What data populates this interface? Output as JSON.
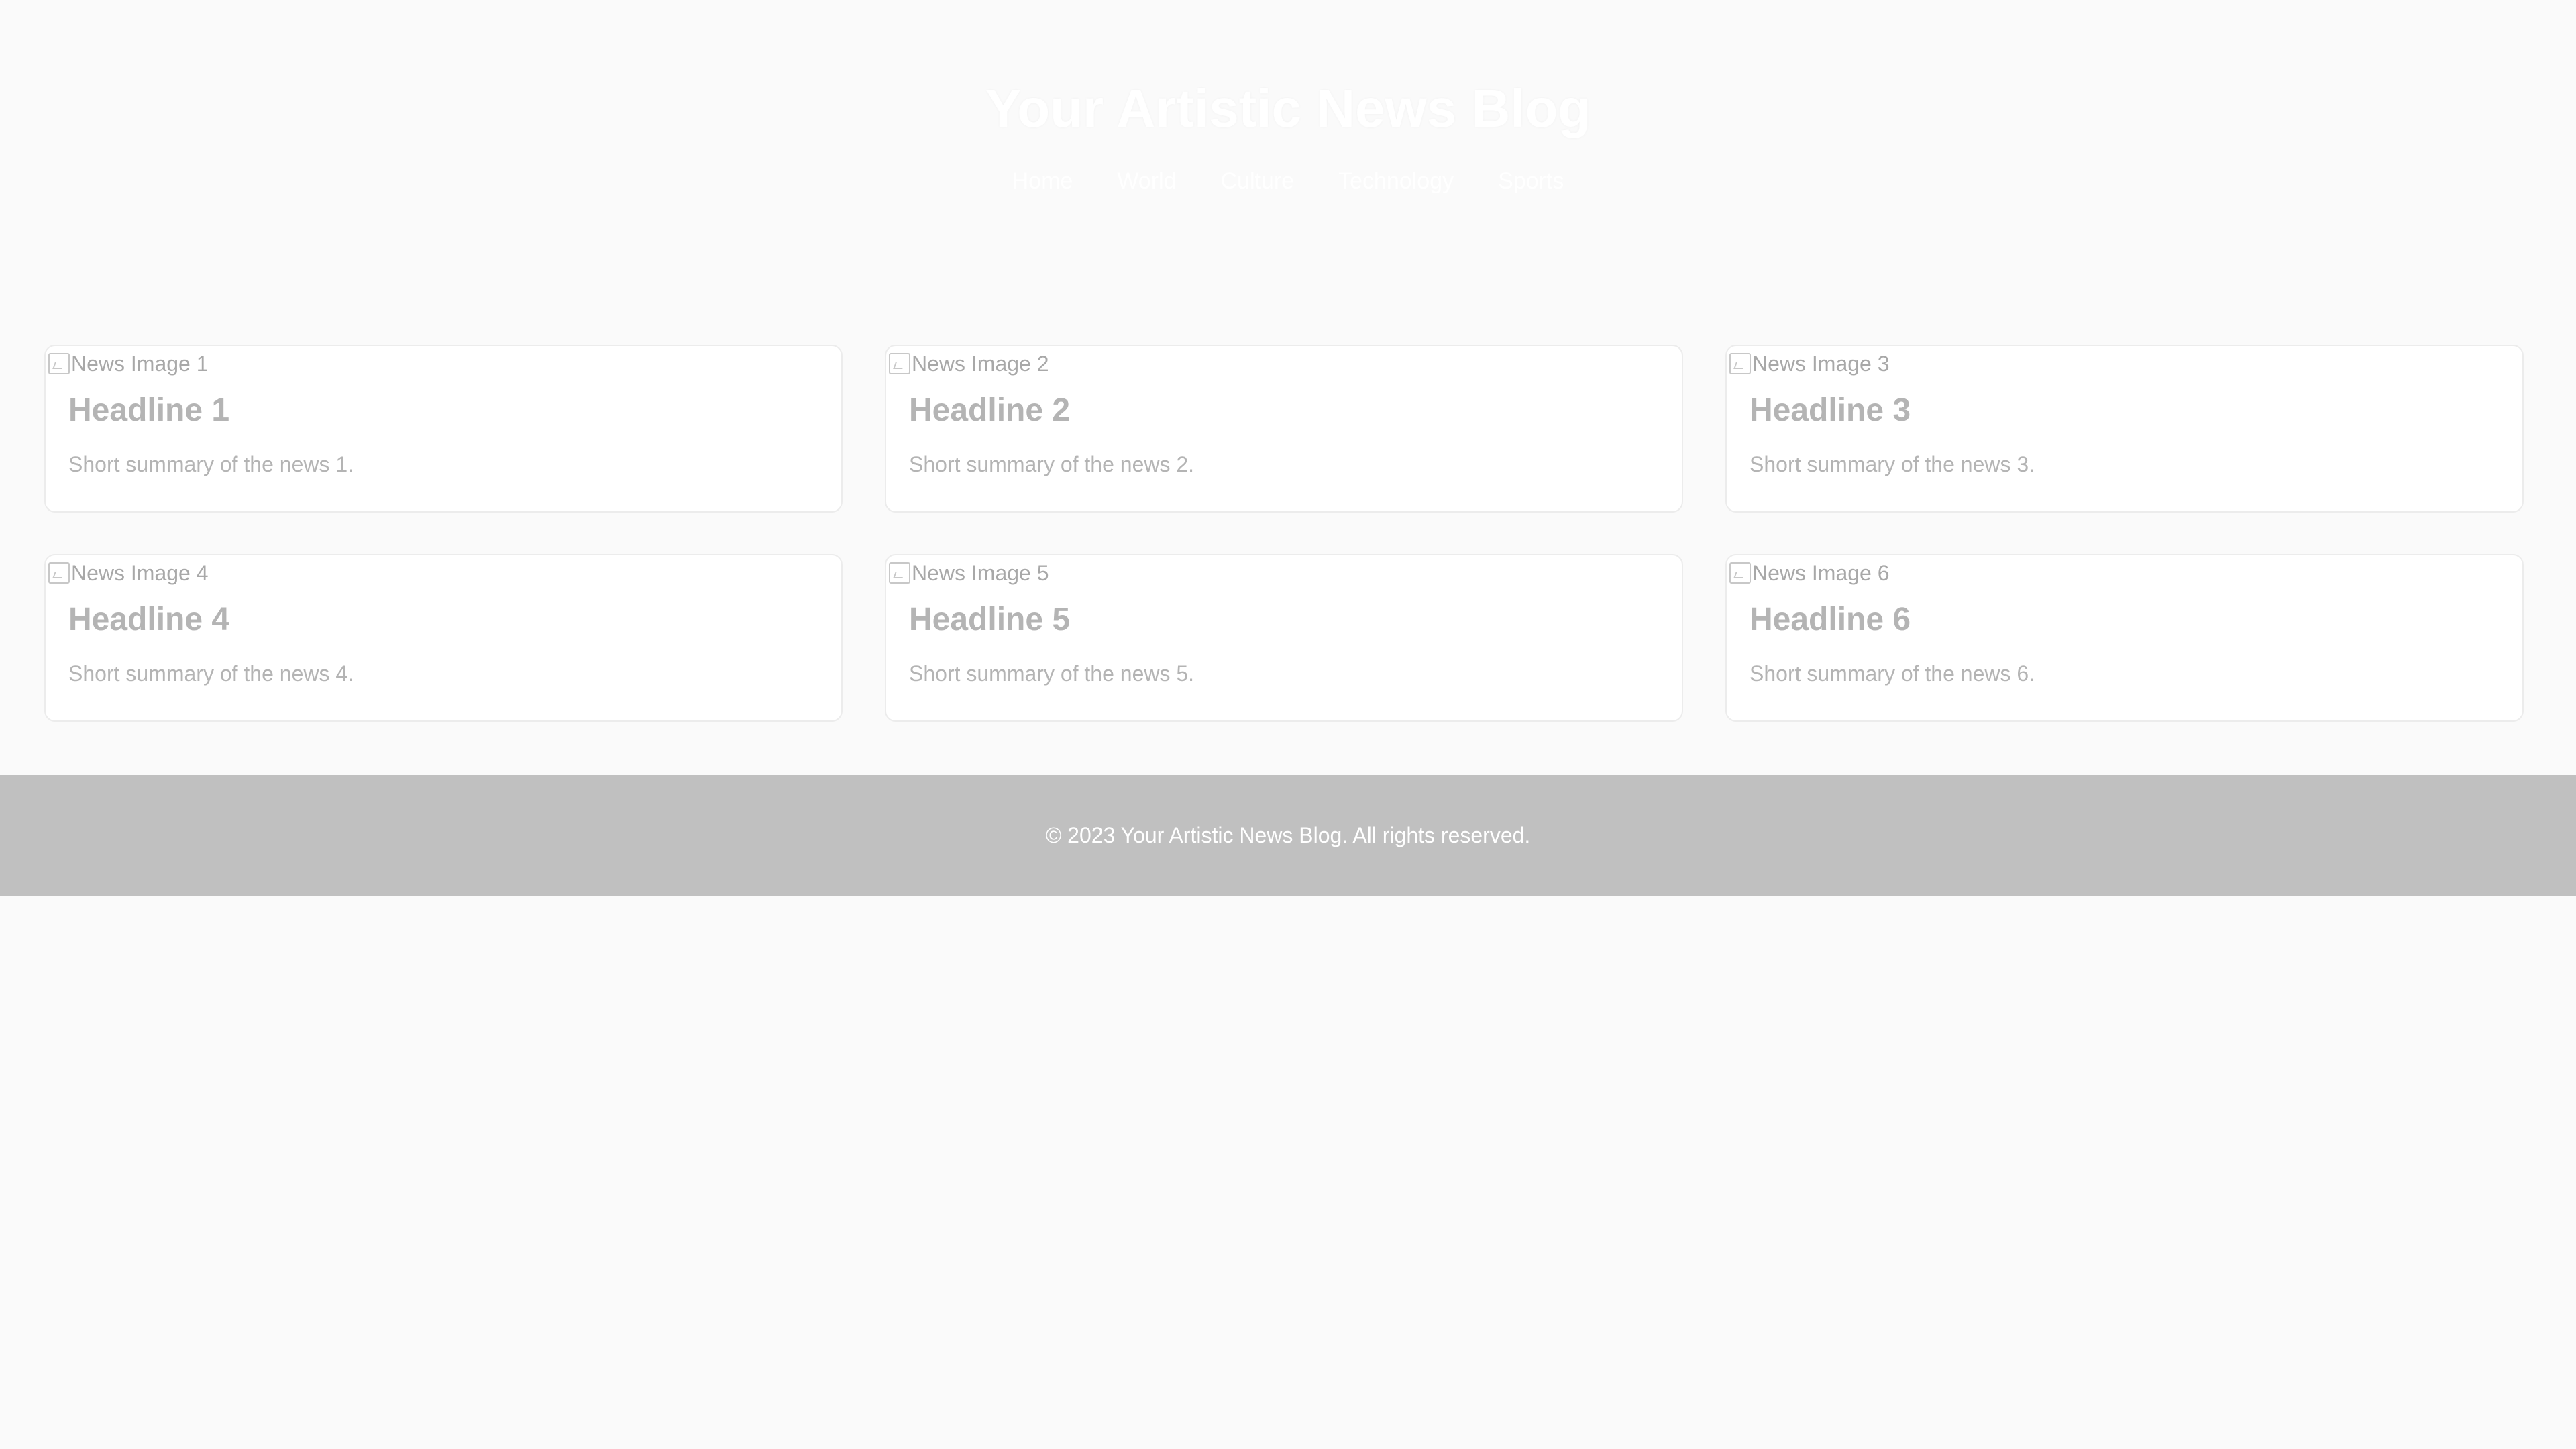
{
  "header": {
    "title": "Your Artistic News Blog",
    "nav": [
      {
        "label": "Home"
      },
      {
        "label": "World"
      },
      {
        "label": "Culture"
      },
      {
        "label": "Technology"
      },
      {
        "label": "Sports"
      }
    ]
  },
  "cards": [
    {
      "image_alt": "News Image 1",
      "headline": "Headline 1",
      "summary": "Short summary of the news 1."
    },
    {
      "image_alt": "News Image 2",
      "headline": "Headline 2",
      "summary": "Short summary of the news 2."
    },
    {
      "image_alt": "News Image 3",
      "headline": "Headline 3",
      "summary": "Short summary of the news 3."
    },
    {
      "image_alt": "News Image 4",
      "headline": "Headline 4",
      "summary": "Short summary of the news 4."
    },
    {
      "image_alt": "News Image 5",
      "headline": "Headline 5",
      "summary": "Short summary of the news 5."
    },
    {
      "image_alt": "News Image 6",
      "headline": "Headline 6",
      "summary": "Short summary of the news 6."
    }
  ],
  "footer": {
    "text": "© 2023 Your Artistic News Blog. All rights reserved."
  },
  "colors": {
    "background": "#fafafa",
    "footer_background": "#c0c0c0",
    "card_text": "#b4b4b4"
  }
}
